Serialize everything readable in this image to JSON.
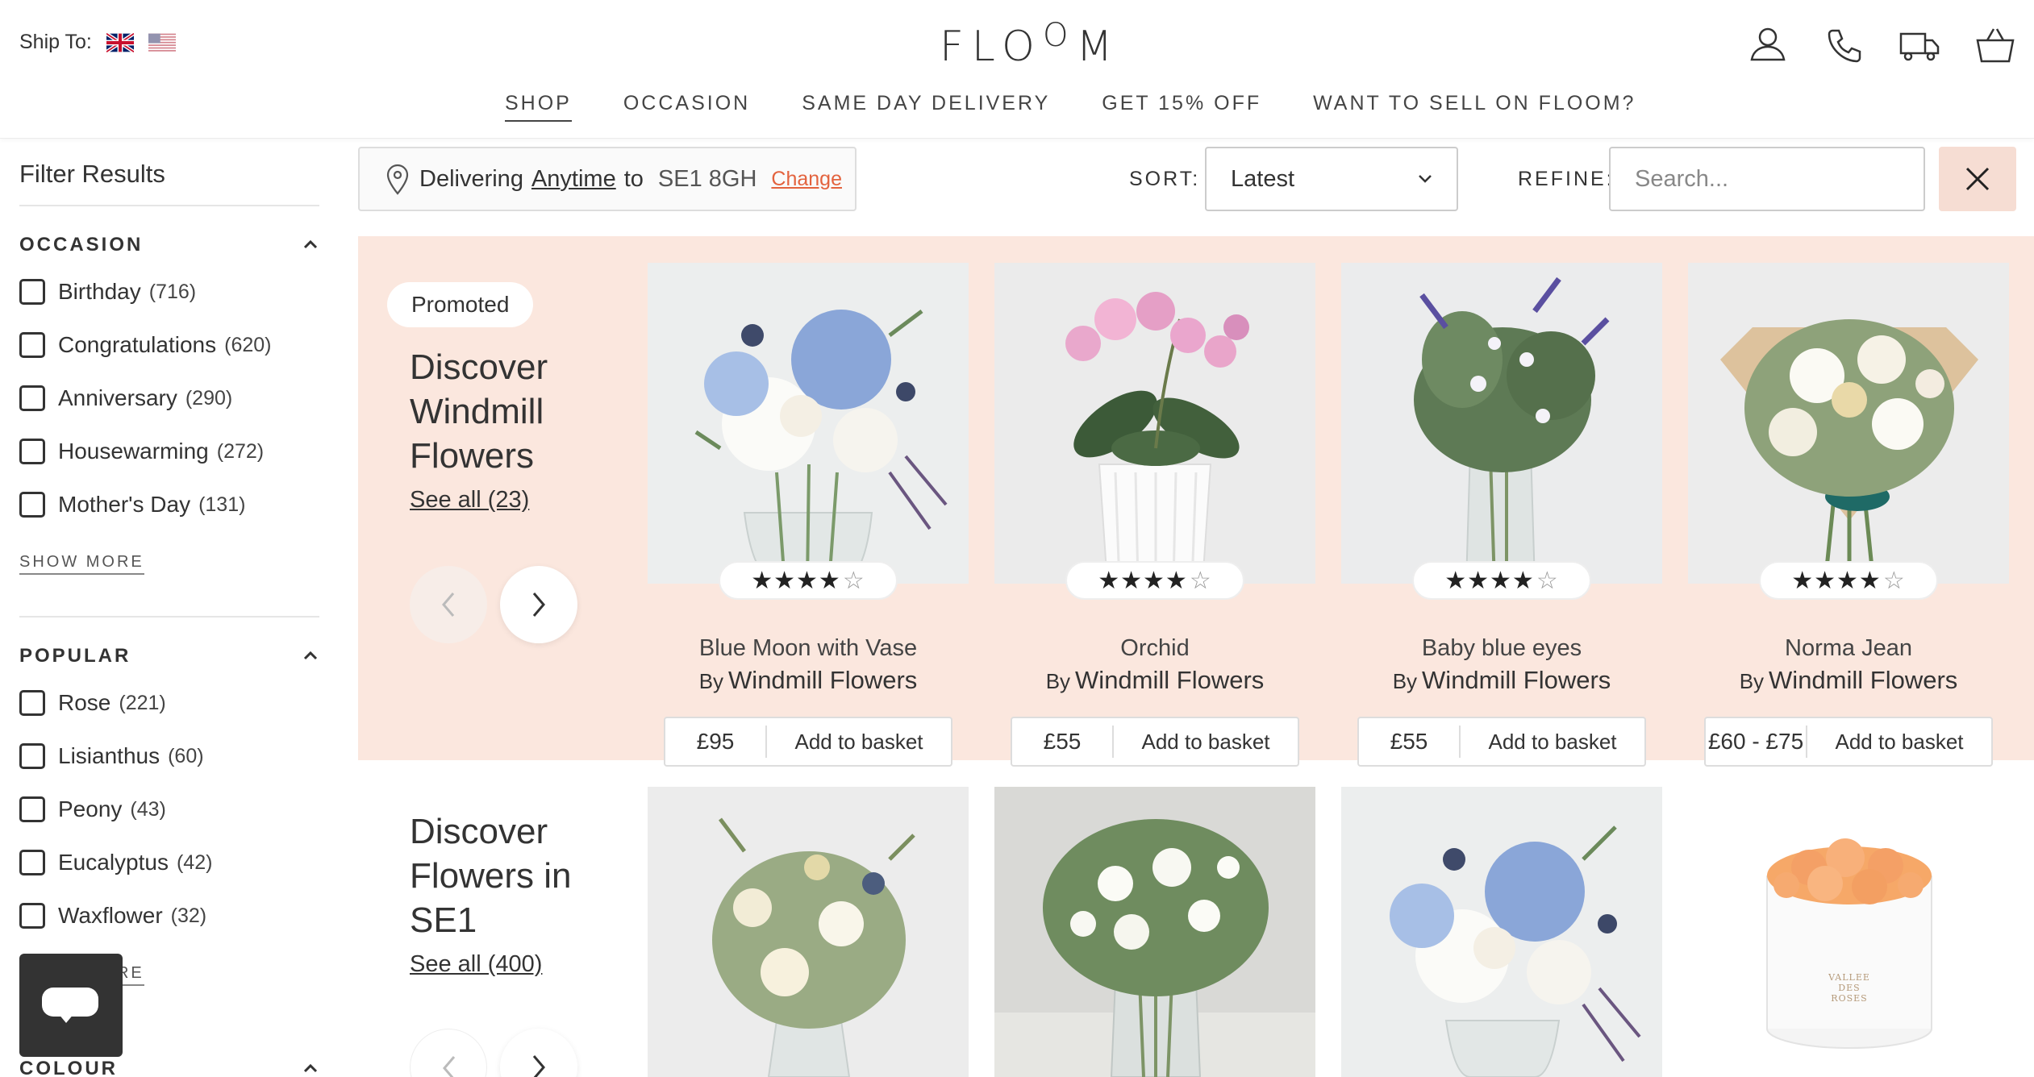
{
  "header": {
    "ship_to": "Ship To:",
    "logo": "FLOOM",
    "nav": [
      "SHOP",
      "OCCASION",
      "SAME DAY DELIVERY",
      "GET 15% OFF",
      "WANT TO SELL ON FLOOM?"
    ]
  },
  "sidebar": {
    "title": "Filter Results",
    "occasion": {
      "heading": "OCCASION",
      "options": [
        {
          "label": "Birthday",
          "count": "(716)"
        },
        {
          "label": "Congratulations",
          "count": "(620)"
        },
        {
          "label": "Anniversary",
          "count": "(290)"
        },
        {
          "label": "Housewarming",
          "count": "(272)"
        },
        {
          "label": "Mother's Day",
          "count": "(131)"
        }
      ],
      "show_more": "SHOW MORE"
    },
    "popular": {
      "heading": "POPULAR",
      "options": [
        {
          "label": "Rose",
          "count": "(221)"
        },
        {
          "label": "Lisianthus",
          "count": "(60)"
        },
        {
          "label": "Peony",
          "count": "(43)"
        },
        {
          "label": "Eucalyptus",
          "count": "(42)"
        },
        {
          "label": "Waxflower",
          "count": "(32)"
        }
      ],
      "show_more": "SHOW MORE"
    },
    "colour": {
      "heading": "COLOUR"
    }
  },
  "toolbar": {
    "delivering": "Delivering",
    "anytime": "Anytime",
    "to": "to",
    "postcode": "SE1 8GH",
    "change": "Change",
    "sort_label": "SORT:",
    "sort_value": "Latest",
    "refine_label": "REFINE:",
    "search_placeholder": "Search..."
  },
  "promo": {
    "badge": "Promoted",
    "title": "Discover Windmill Flowers",
    "see_all": "See all (23)",
    "products": [
      {
        "name": "Blue Moon with Vase",
        "by": "By",
        "vendor": "Windmill Flowers",
        "price": "£95",
        "add": "Add to basket",
        "rating": 4.5
      },
      {
        "name": "Orchid",
        "by": "By",
        "vendor": "Windmill Flowers",
        "price": "£55",
        "add": "Add to basket",
        "rating": 4.5
      },
      {
        "name": "Baby blue eyes",
        "by": "By",
        "vendor": "Windmill Flowers",
        "price": "£55",
        "add": "Add to basket",
        "rating": 4.5
      },
      {
        "name": "Norma Jean",
        "by": "By",
        "vendor": "Windmill Flowers",
        "price": "£60 - £75",
        "add": "Add to basket",
        "rating": 4.5
      }
    ]
  },
  "local": {
    "title": "Discover Flowers in SE1",
    "see_all": "See all (400)",
    "box_label": "VALLEE DES ROSES"
  },
  "colors": {
    "accent": "#e3633e",
    "band": "#fbe7de",
    "close_bg": "#f6ddd3"
  }
}
